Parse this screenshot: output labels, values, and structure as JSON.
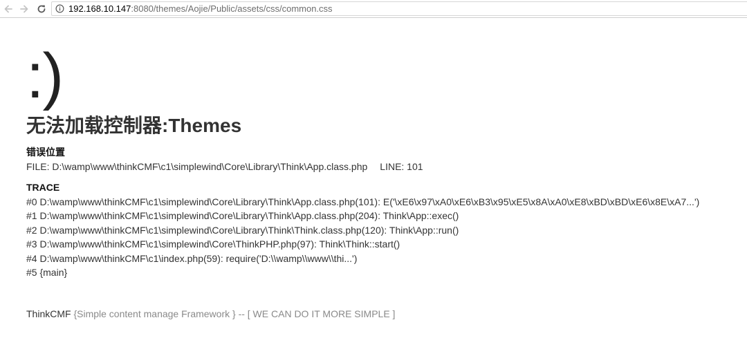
{
  "browser": {
    "url_host": "192.168.10.147",
    "url_path": ":8080/themes/Aojie/Public/assets/css/common.css"
  },
  "error": {
    "face": ":)",
    "title": "无法加载控制器:Themes",
    "location_heading": "错误位置",
    "file_label": "FILE: D:\\wamp\\www\\thinkCMF\\c1\\simplewind\\Core\\Library\\Think\\App.class.php",
    "line_label": "LINE: 101",
    "trace_heading": "TRACE",
    "trace": [
      "#0 D:\\wamp\\www\\thinkCMF\\c1\\simplewind\\Core\\Library\\Think\\App.class.php(101): E('\\xE6\\x97\\xA0\\xE6\\xB3\\x95\\xE5\\x8A\\xA0\\xE8\\xBD\\xBD\\xE6\\x8E\\xA7...')",
      "#1 D:\\wamp\\www\\thinkCMF\\c1\\simplewind\\Core\\Library\\Think\\App.class.php(204): Think\\App::exec()",
      "#2 D:\\wamp\\www\\thinkCMF\\c1\\simplewind\\Core\\Library\\Think\\Think.class.php(120): Think\\App::run()",
      "#3 D:\\wamp\\www\\thinkCMF\\c1\\simplewind\\Core\\ThinkPHP.php(97): Think\\Think::start()",
      "#4 D:\\wamp\\www\\thinkCMF\\c1\\index.php(59): require('D:\\\\wamp\\\\www\\\\thi...')",
      "#5 {main}"
    ]
  },
  "footer": {
    "brand": "ThinkCMF",
    "slogan": " {Simple content manage Framework } -- [ WE CAN DO IT MORE SIMPLE ]"
  },
  "icons": {
    "back": "back-arrow-icon",
    "forward": "forward-arrow-icon",
    "reload": "reload-icon",
    "info": "info-icon"
  },
  "colors": {
    "text": "#333333",
    "slogan": "#8a8a8a",
    "url_path": "#6e6e6e"
  }
}
